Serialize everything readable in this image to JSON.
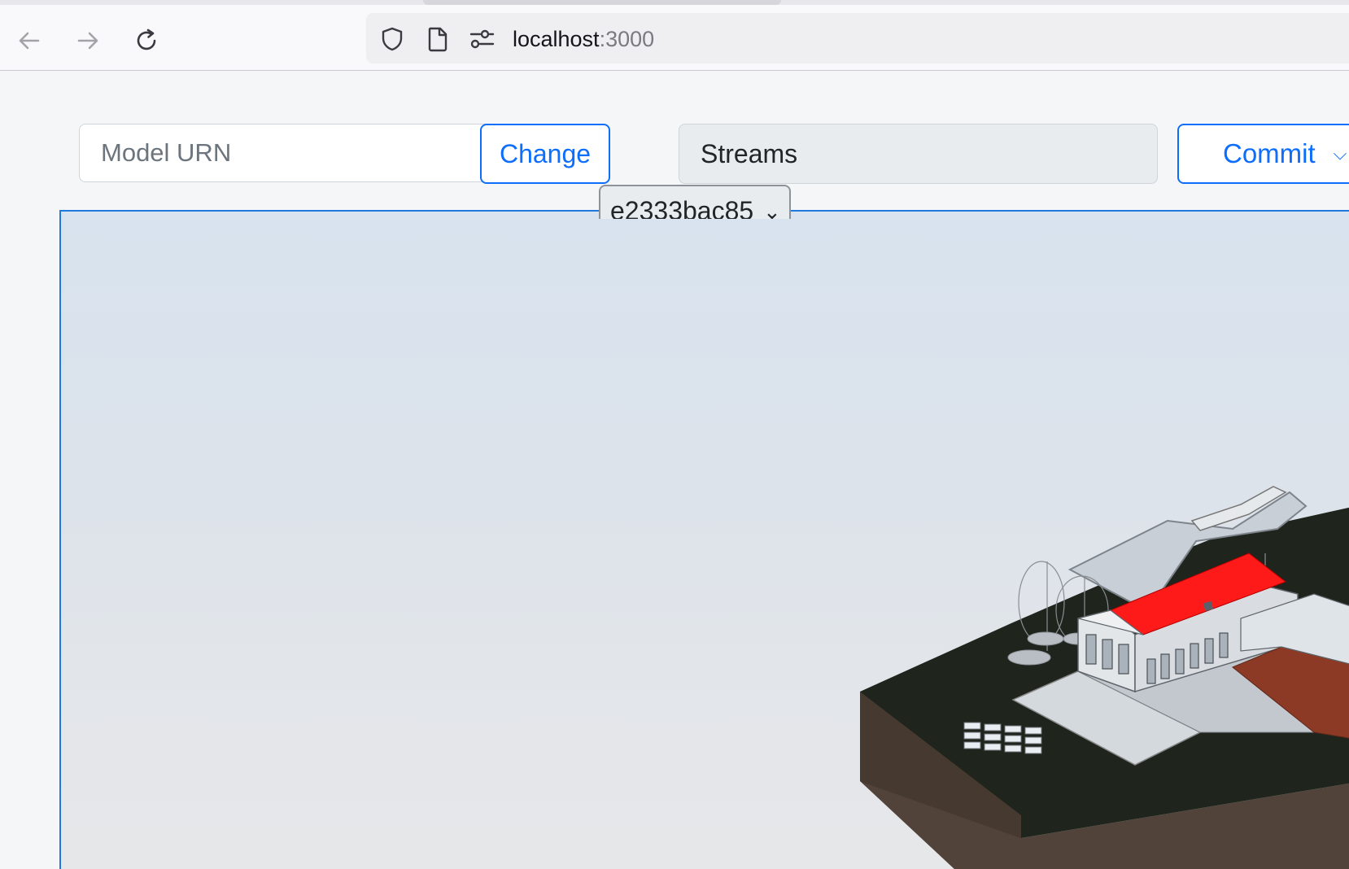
{
  "browser": {
    "url_host": "localhost",
    "url_port": ":3000",
    "icons": [
      "back-arrow-icon",
      "forward-arrow-icon",
      "reload-icon",
      "shield-icon",
      "page-icon",
      "permissions-icon"
    ]
  },
  "controls": {
    "urn_placeholder": "Model URN",
    "change_label": "Change",
    "streams_label": "Streams",
    "commit_label": "Commit",
    "commit_chip": "e2333bac85"
  },
  "colors": {
    "accent": "#0d6efd",
    "roof": "#ff1a1a",
    "terrain": "#1f241d",
    "soil": "#52433a"
  }
}
